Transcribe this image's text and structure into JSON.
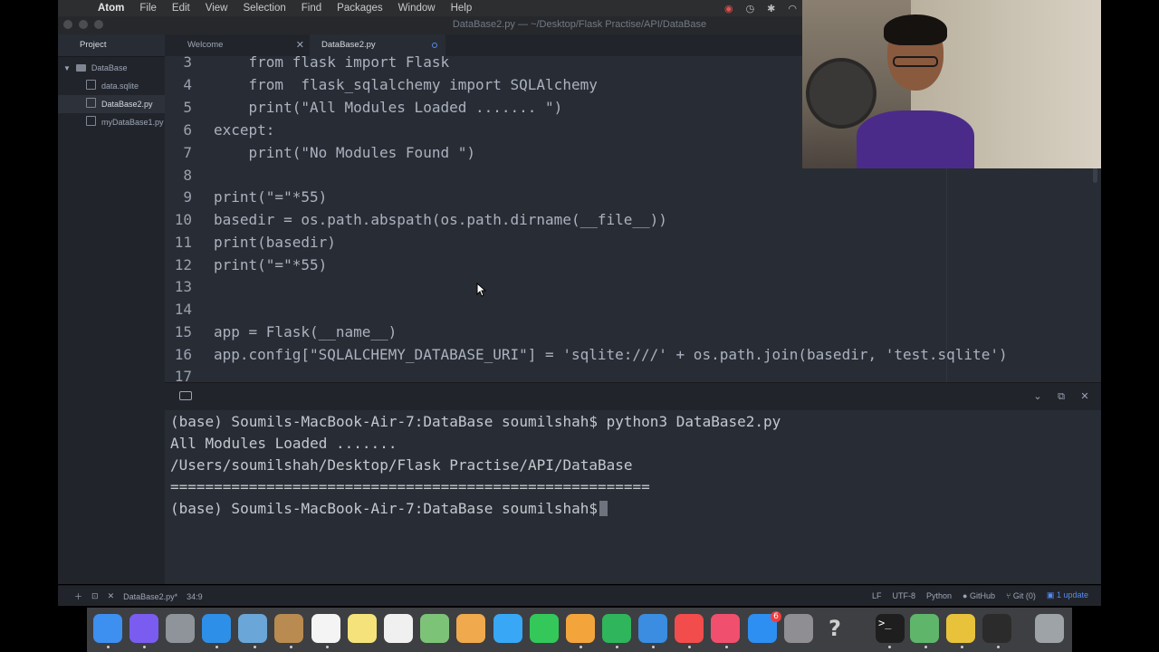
{
  "menubar": {
    "app": "Atom",
    "items": [
      "File",
      "Edit",
      "View",
      "Selection",
      "Find",
      "Packages",
      "Window",
      "Help"
    ]
  },
  "window": {
    "title": "DataBase2.py — ~/Desktop/Flask Practise/API/DataBase"
  },
  "sidebar": {
    "tab_label": "Project",
    "root": "DataBase",
    "files": [
      "data.sqlite",
      "DataBase2.py",
      "myDataBase1.py"
    ],
    "selected_index": 1
  },
  "tabs": [
    {
      "label": "Welcome",
      "active": false
    },
    {
      "label": "DataBase2.py",
      "active": true,
      "modified": true
    }
  ],
  "editor": {
    "lines": [
      {
        "n": "3",
        "text": "    from flask import Flask"
      },
      {
        "n": "4",
        "text": "    from  flask_sqlalchemy import SQLAlchemy"
      },
      {
        "n": "5",
        "text": "    print(\"All Modules Loaded ....... \")"
      },
      {
        "n": "6",
        "text": "except:"
      },
      {
        "n": "7",
        "text": "    print(\"No Modules Found \")"
      },
      {
        "n": "8",
        "text": ""
      },
      {
        "n": "9",
        "text": "print(\"=\"*55)"
      },
      {
        "n": "10",
        "text": "basedir = os.path.abspath(os.path.dirname(__file__))"
      },
      {
        "n": "11",
        "text": "print(basedir)"
      },
      {
        "n": "12",
        "text": "print(\"=\"*55)"
      },
      {
        "n": "13",
        "text": ""
      },
      {
        "n": "14",
        "text": ""
      },
      {
        "n": "15",
        "text": "app = Flask(__name__)"
      },
      {
        "n": "16",
        "text": "app.config[\"SQLALCHEMY_DATABASE_URI\"] = 'sqlite:///' + os.path.join(basedir, 'test.sqlite')"
      },
      {
        "n": "17",
        "text": ""
      }
    ]
  },
  "terminal": {
    "lines": [
      "(base) Soumils-MacBook-Air-7:DataBase soumilshah$ python3 DataBase2.py",
      "All Modules Loaded .......",
      "/Users/soumilshah/Desktop/Flask Practise/API/DataBase",
      "=======================================================",
      "(base) Soumils-MacBook-Air-7:DataBase soumilshah$"
    ]
  },
  "statusbar": {
    "file": "DataBase2.py*",
    "position": "34:9",
    "line_ending": "LF",
    "encoding": "UTF-8",
    "grammar": "Python",
    "github": "GitHub",
    "git": "Git (0)",
    "updates": "1 update"
  },
  "dock": {
    "icons": [
      {
        "name": "finder",
        "color": "#3d8ff0"
      },
      {
        "name": "siri",
        "color": "#7a5cf0"
      },
      {
        "name": "launchpad",
        "color": "#8e9499"
      },
      {
        "name": "safari",
        "color": "#2d8fe8"
      },
      {
        "name": "preview",
        "color": "#6aa6d8"
      },
      {
        "name": "notefile",
        "color": "#b98b50"
      },
      {
        "name": "calendar",
        "color": "#f4f4f4"
      },
      {
        "name": "notes",
        "color": "#f5e27a"
      },
      {
        "name": "reminders",
        "color": "#f0f0f0"
      },
      {
        "name": "maps",
        "color": "#7cc377"
      },
      {
        "name": "photos",
        "color": "#f0a94c"
      },
      {
        "name": "messages",
        "color": "#38a7f5"
      },
      {
        "name": "facetime",
        "color": "#34c759"
      },
      {
        "name": "pages",
        "color": "#f3a53c"
      },
      {
        "name": "numbers",
        "color": "#2fb55b"
      },
      {
        "name": "keynote",
        "color": "#3a8de0"
      },
      {
        "name": "news",
        "color": "#f24c4c"
      },
      {
        "name": "music",
        "color": "#f14f6e"
      },
      {
        "name": "app-store",
        "color": "#2e8ff2"
      },
      {
        "name": "system-preferences",
        "color": "#8e8e93"
      },
      {
        "name": "help",
        "color": "#3d3f42"
      },
      {
        "name": "terminal",
        "color": "#1e1e1e"
      },
      {
        "name": "atom",
        "color": "#5fb56a"
      },
      {
        "name": "chrome",
        "color": "#e8c23a"
      },
      {
        "name": "obs",
        "color": "#2b2b2b"
      },
      {
        "name": "trash",
        "color": "#9ea3a8"
      }
    ],
    "badge": "6"
  },
  "colors": {
    "editor_bg": "#282c34",
    "panel_bg": "#21252b",
    "accent": "#568af2"
  }
}
